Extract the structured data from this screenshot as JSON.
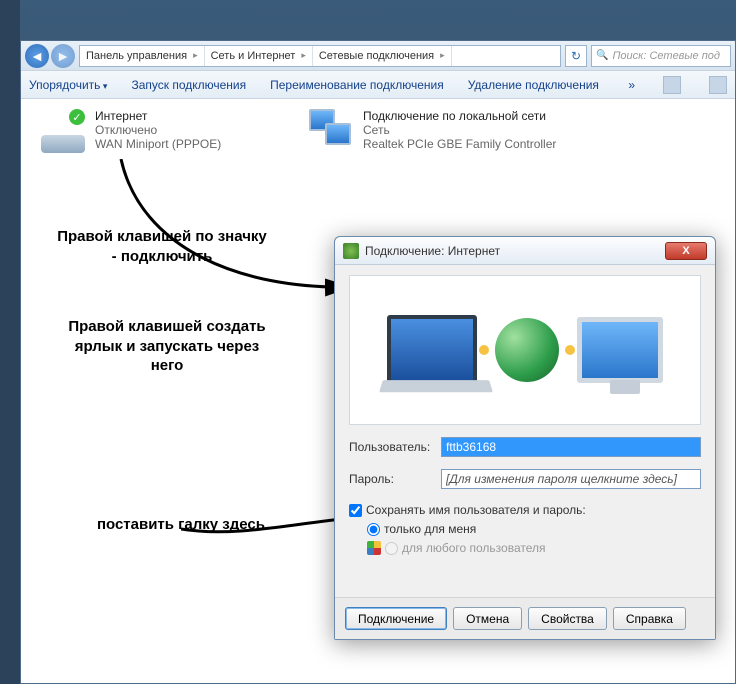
{
  "explorer": {
    "breadcrumb": [
      "Панель управления",
      "Сеть и Интернет",
      "Сетевые подключения"
    ],
    "search_placeholder": "Поиск: Сетевые под",
    "toolbar": {
      "organize": "Упорядочить",
      "start": "Запуск подключения",
      "rename": "Переименование подключения",
      "delete": "Удаление подключения",
      "more": "»"
    },
    "items": {
      "internet": {
        "title": "Интернет",
        "status": "Отключено",
        "device": "WAN Miniport (PPPOE)"
      },
      "lan": {
        "title": "Подключение по локальной сети",
        "status": "Сеть",
        "device": "Realtek PCIe GBE Family Controller"
      }
    }
  },
  "annotations": {
    "a1": "Правой клавишей по значку - подключить",
    "a2": "Правой клавишей создать ярлык и запускать через него",
    "a3": "поставить галку здесь"
  },
  "dialog": {
    "title": "Подключение: Интернет",
    "user_label": "Пользователь:",
    "user_value": "fttb36168",
    "pass_label": "Пароль:",
    "pass_value": "[Для изменения пароля щелкните здесь]",
    "chk_save": "Сохранять имя пользователя и пароль:",
    "radio_me": "только для меня",
    "radio_all": "для любого пользователя",
    "btn_connect": "Подключение",
    "btn_cancel": "Отмена",
    "btn_props": "Свойства",
    "btn_help": "Справка"
  }
}
